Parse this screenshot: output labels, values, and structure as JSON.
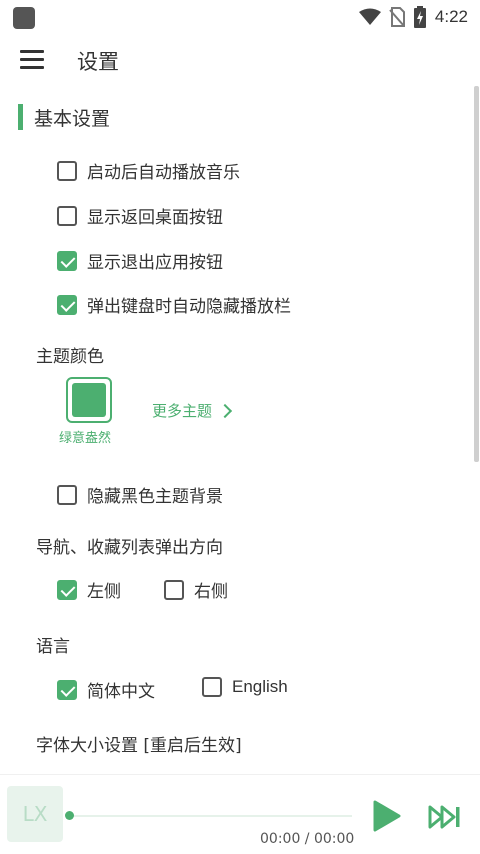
{
  "status": {
    "time": "4:22"
  },
  "header": {
    "title": "设置"
  },
  "section": {
    "title": "基本设置"
  },
  "basic_options": [
    {
      "label": "启动后自动播放音乐",
      "checked": false
    },
    {
      "label": "显示返回桌面按钮",
      "checked": false
    },
    {
      "label": "显示退出应用按钮",
      "checked": true
    },
    {
      "label": "弹出键盘时自动隐藏播放栏",
      "checked": true
    }
  ],
  "theme": {
    "label": "主题颜色",
    "selected_name": "绿意盎然",
    "selected_color": "#4caf70",
    "more_label": "更多主题",
    "hide_black_bg_label": "隐藏黑色主题背景",
    "hide_black_bg_checked": false
  },
  "direction": {
    "label": "导航、收藏列表弹出方向",
    "options": [
      {
        "label": "左侧",
        "checked": true
      },
      {
        "label": "右侧",
        "checked": false
      }
    ]
  },
  "language": {
    "label": "语言",
    "options": [
      {
        "label": "简体中文",
        "checked": true
      },
      {
        "label": "English",
        "checked": false
      }
    ]
  },
  "font_size": {
    "label": "字体大小设置 [重启后生效]"
  },
  "player": {
    "cover_text": "LX",
    "time": "00:00 / 00:00",
    "progress": 0
  },
  "colors": {
    "accent": "#4caf70",
    "text": "#333333"
  }
}
